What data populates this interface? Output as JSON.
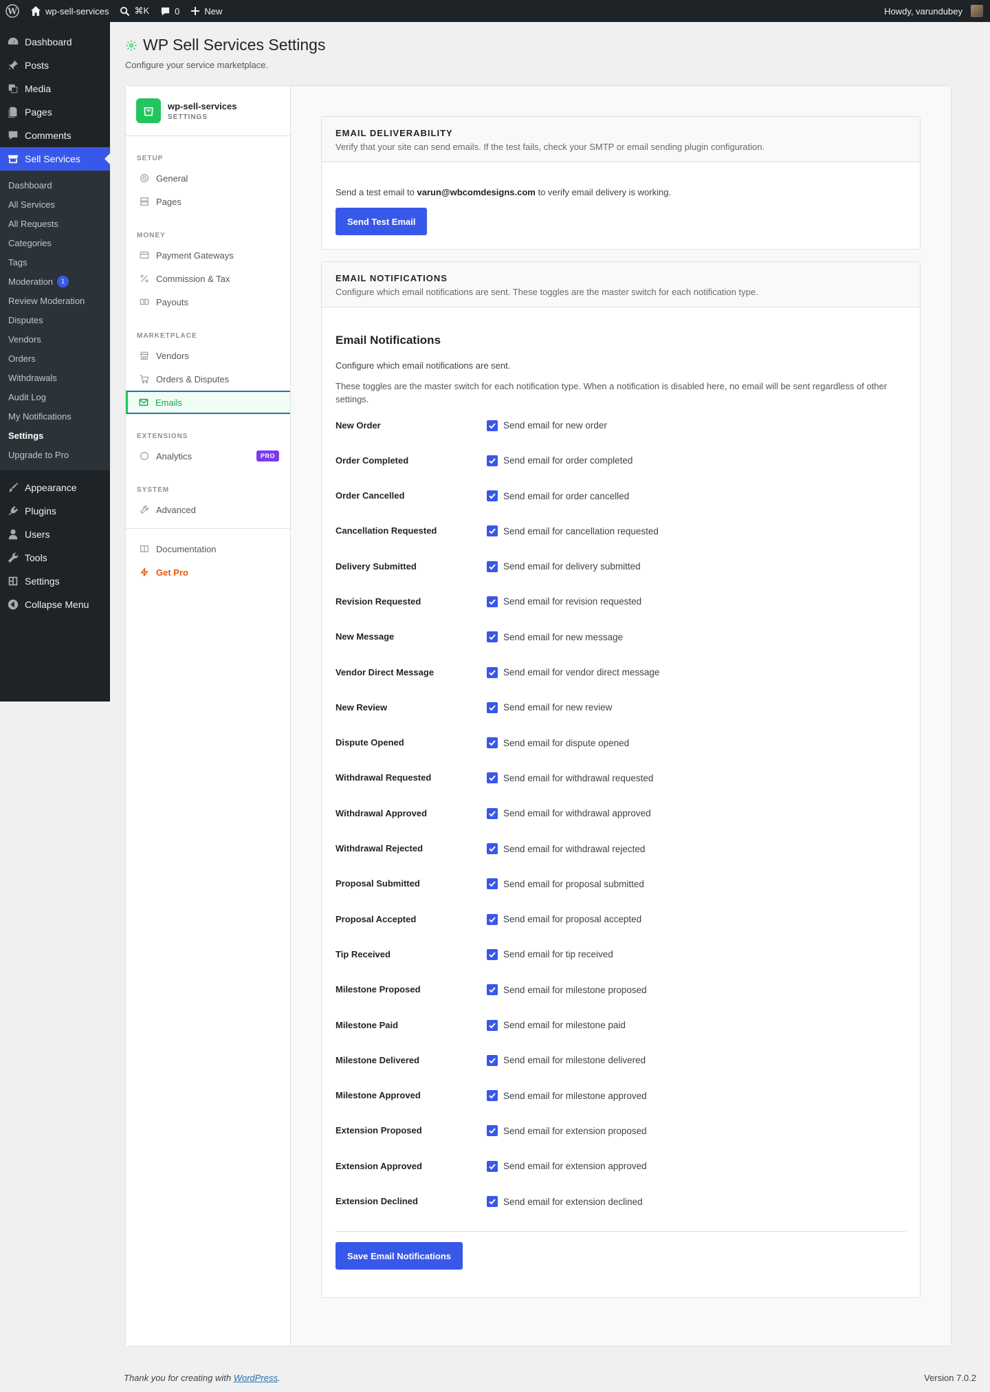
{
  "adminbar": {
    "site_name": "wp-sell-services",
    "search_shortcut": "⌘K",
    "comments_count": "0",
    "new_label": "New",
    "howdy": "Howdy, varundubey"
  },
  "adminmenu": {
    "top_items_before": [
      {
        "label": "Dashboard",
        "icon": "dashboard-icon"
      },
      {
        "label": "Posts",
        "icon": "pin-icon"
      },
      {
        "label": "Media",
        "icon": "media-icon"
      },
      {
        "label": "Pages",
        "icon": "pages-icon"
      },
      {
        "label": "Comments",
        "icon": "comment-icon"
      }
    ],
    "current": {
      "label": "Sell Services",
      "icon": "store-icon"
    },
    "submenu": [
      {
        "label": "Dashboard"
      },
      {
        "label": "All Services"
      },
      {
        "label": "All Requests"
      },
      {
        "label": "Categories"
      },
      {
        "label": "Tags"
      },
      {
        "label": "Moderation",
        "badge": "1"
      },
      {
        "label": "Review Moderation"
      },
      {
        "label": "Disputes"
      },
      {
        "label": "Vendors"
      },
      {
        "label": "Orders"
      },
      {
        "label": "Withdrawals"
      },
      {
        "label": "Audit Log"
      },
      {
        "label": "My Notifications"
      },
      {
        "label": "Settings",
        "active": true
      },
      {
        "label": "Upgrade to Pro"
      }
    ],
    "top_items_after": [
      {
        "label": "Appearance",
        "icon": "brush-icon"
      },
      {
        "label": "Plugins",
        "icon": "plugin-icon"
      },
      {
        "label": "Users",
        "icon": "user-icon"
      },
      {
        "label": "Tools",
        "icon": "wrench-icon"
      },
      {
        "label": "Settings",
        "icon": "settings-icon"
      },
      {
        "label": "Collapse Menu",
        "icon": "collapse-icon"
      }
    ]
  },
  "page": {
    "title": "WP Sell Services Settings",
    "subtitle": "Configure your service marketplace."
  },
  "settings_nav": {
    "brand_name": "wp-sell-services",
    "brand_sub": "SETTINGS",
    "sections": [
      {
        "title": "SETUP",
        "items": [
          {
            "label": "General",
            "icon": "gear-icon"
          },
          {
            "label": "Pages",
            "icon": "layout-icon"
          }
        ]
      },
      {
        "title": "MONEY",
        "items": [
          {
            "label": "Payment Gateways",
            "icon": "card-icon"
          },
          {
            "label": "Commission & Tax",
            "icon": "percent-icon"
          },
          {
            "label": "Payouts",
            "icon": "cash-icon"
          }
        ]
      },
      {
        "title": "MARKETPLACE",
        "items": [
          {
            "label": "Vendors",
            "icon": "store-icon"
          },
          {
            "label": "Orders & Disputes",
            "icon": "cart-icon"
          },
          {
            "label": "Emails",
            "icon": "mail-icon",
            "active": true
          }
        ]
      },
      {
        "title": "EXTENSIONS",
        "items": [
          {
            "label": "Analytics",
            "icon": "circle-icon",
            "badge": "PRO"
          }
        ]
      },
      {
        "title": "SYSTEM",
        "items": [
          {
            "label": "Advanced",
            "icon": "wrench-icon"
          }
        ]
      }
    ],
    "footer_items": [
      {
        "label": "Documentation",
        "icon": "book-icon"
      },
      {
        "label": "Get Pro",
        "icon": "bolt-icon"
      }
    ]
  },
  "deliverability": {
    "title": "EMAIL DELIVERABILITY",
    "desc": "Verify that your site can send emails. If the test fails, check your SMTP or email sending plugin configuration.",
    "line_pre": "Send a test email to ",
    "email": "varun@wbcomdesigns.com",
    "line_post": " to verify email delivery is working.",
    "button": "Send Test Email"
  },
  "notifications": {
    "title": "EMAIL NOTIFICATIONS",
    "desc": "Configure which email notifications are sent. These toggles are the master switch for each notification type.",
    "heading": "Email Notifications",
    "intro": "Configure which email notifications are sent.",
    "intro2": "These toggles are the master switch for each notification type. When a notification is disabled here, no email will be sent regardless of other settings.",
    "rows": [
      {
        "label": "New Order",
        "option": "Send email for new order",
        "checked": true
      },
      {
        "label": "Order Completed",
        "option": "Send email for order completed",
        "checked": true
      },
      {
        "label": "Order Cancelled",
        "option": "Send email for order cancelled",
        "checked": true
      },
      {
        "label": "Cancellation Requested",
        "option": "Send email for cancellation requested",
        "checked": true
      },
      {
        "label": "Delivery Submitted",
        "option": "Send email for delivery submitted",
        "checked": true
      },
      {
        "label": "Revision Requested",
        "option": "Send email for revision requested",
        "checked": true
      },
      {
        "label": "New Message",
        "option": "Send email for new message",
        "checked": true
      },
      {
        "label": "Vendor Direct Message",
        "option": "Send email for vendor direct message",
        "checked": true
      },
      {
        "label": "New Review",
        "option": "Send email for new review",
        "checked": true
      },
      {
        "label": "Dispute Opened",
        "option": "Send email for dispute opened",
        "checked": true
      },
      {
        "label": "Withdrawal Requested",
        "option": "Send email for withdrawal requested",
        "checked": true
      },
      {
        "label": "Withdrawal Approved",
        "option": "Send email for withdrawal approved",
        "checked": true
      },
      {
        "label": "Withdrawal Rejected",
        "option": "Send email for withdrawal rejected",
        "checked": true
      },
      {
        "label": "Proposal Submitted",
        "option": "Send email for proposal submitted",
        "checked": true
      },
      {
        "label": "Proposal Accepted",
        "option": "Send email for proposal accepted",
        "checked": true
      },
      {
        "label": "Tip Received",
        "option": "Send email for tip received",
        "checked": true
      },
      {
        "label": "Milestone Proposed",
        "option": "Send email for milestone proposed",
        "checked": true
      },
      {
        "label": "Milestone Paid",
        "option": "Send email for milestone paid",
        "checked": true
      },
      {
        "label": "Milestone Delivered",
        "option": "Send email for milestone delivered",
        "checked": true
      },
      {
        "label": "Milestone Approved",
        "option": "Send email for milestone approved",
        "checked": true
      },
      {
        "label": "Extension Proposed",
        "option": "Send email for extension proposed",
        "checked": true
      },
      {
        "label": "Extension Approved",
        "option": "Send email for extension approved",
        "checked": true
      },
      {
        "label": "Extension Declined",
        "option": "Send email for extension declined",
        "checked": true
      }
    ],
    "save_button": "Save Email Notifications"
  },
  "footer": {
    "thanks_pre": "Thank you for creating with ",
    "thanks_link": "WordPress",
    "thanks_post": ".",
    "version": "Version 7.0.2"
  },
  "colors": {
    "primary": "#3858e9",
    "brand_green": "#22c55e",
    "pro_purple": "#7c3aed",
    "getpro_orange": "#ea580c"
  }
}
